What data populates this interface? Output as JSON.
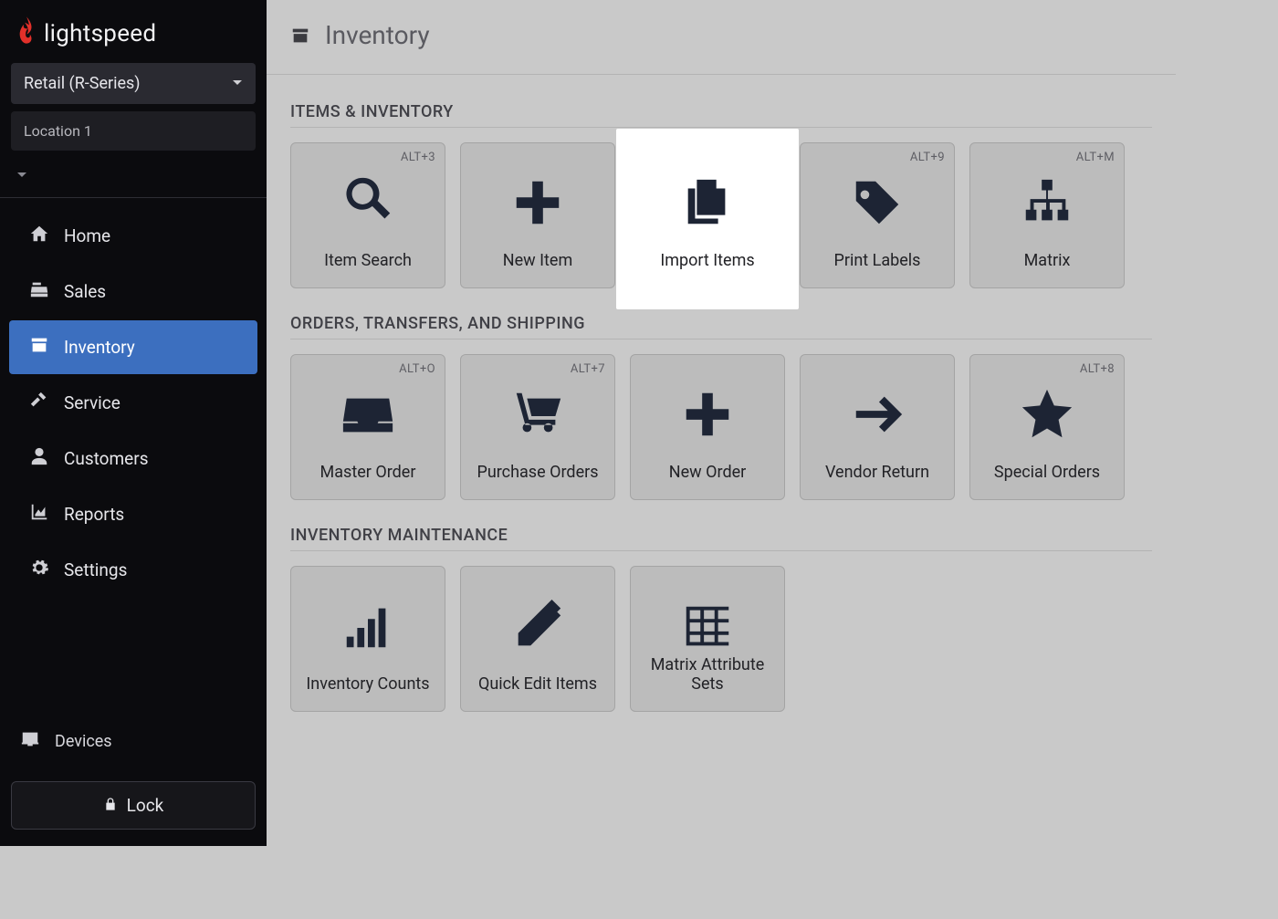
{
  "brand": "lightspeed",
  "sidebar": {
    "product_selector": "Retail (R-Series)",
    "location_selector": "Location 1",
    "nav": [
      {
        "id": "home",
        "label": "Home"
      },
      {
        "id": "sales",
        "label": "Sales"
      },
      {
        "id": "inventory",
        "label": "Inventory"
      },
      {
        "id": "service",
        "label": "Service"
      },
      {
        "id": "customers",
        "label": "Customers"
      },
      {
        "id": "reports",
        "label": "Reports"
      },
      {
        "id": "settings",
        "label": "Settings"
      }
    ],
    "devices_label": "Devices",
    "lock_label": "Lock"
  },
  "header": {
    "title": "Inventory"
  },
  "sections": [
    {
      "title": "ITEMS & INVENTORY",
      "tiles": [
        {
          "id": "item-search",
          "label": "Item Search",
          "shortcut": "ALT+3",
          "icon": "search"
        },
        {
          "id": "new-item",
          "label": "New Item",
          "shortcut": "",
          "icon": "plus"
        },
        {
          "id": "import-items",
          "label": "Import Items",
          "shortcut": "",
          "icon": "copy",
          "highlighted": true
        },
        {
          "id": "print-labels",
          "label": "Print Labels",
          "shortcut": "ALT+9",
          "icon": "tag"
        },
        {
          "id": "matrix",
          "label": "Matrix",
          "shortcut": "ALT+M",
          "icon": "sitemap"
        }
      ]
    },
    {
      "title": "ORDERS, TRANSFERS, AND SHIPPING",
      "tiles": [
        {
          "id": "master-order",
          "label": "Master Order",
          "shortcut": "ALT+O",
          "icon": "inbox"
        },
        {
          "id": "purchase-orders",
          "label": "Purchase Orders",
          "shortcut": "ALT+7",
          "icon": "cart"
        },
        {
          "id": "new-order",
          "label": "New Order",
          "shortcut": "",
          "icon": "plus"
        },
        {
          "id": "vendor-return",
          "label": "Vendor Return",
          "shortcut": "",
          "icon": "arrow-right"
        },
        {
          "id": "special-orders",
          "label": "Special Orders",
          "shortcut": "ALT+8",
          "icon": "star"
        }
      ]
    },
    {
      "title": "INVENTORY MAINTENANCE",
      "tiles": [
        {
          "id": "inventory-counts",
          "label": "Inventory Counts",
          "shortcut": "",
          "icon": "bars"
        },
        {
          "id": "quick-edit-items",
          "label": "Quick Edit Items",
          "shortcut": "",
          "icon": "pencil"
        },
        {
          "id": "matrix-attribute-sets",
          "label": "Matrix Attribute Sets",
          "shortcut": "",
          "icon": "grid"
        }
      ]
    }
  ]
}
